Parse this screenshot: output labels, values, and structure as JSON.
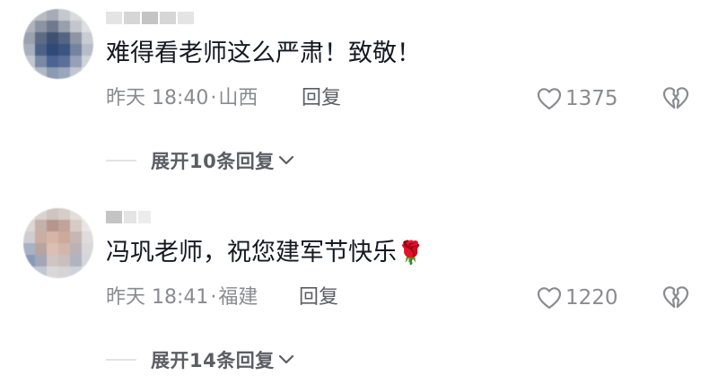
{
  "comments": [
    {
      "text": "难得看老师这么严肃！致敬！",
      "time": "昨天 18:40",
      "separator": "·",
      "location": "山西",
      "reply_label": "回复",
      "like_icon": "heart-outline-icon",
      "likes": "1375",
      "dislike_icon": "broken-heart-icon",
      "expand_label": "展开10条回复",
      "expand_icon": "chevron-down-icon"
    },
    {
      "text": "冯巩老师，祝您建军节快乐",
      "emoji": "🌹",
      "time": "昨天 18:41",
      "separator": "·",
      "location": "福建",
      "reply_label": "回复",
      "like_icon": "heart-outline-icon",
      "likes": "1220",
      "dislike_icon": "broken-heart-icon",
      "expand_label": "展开14条回复",
      "expand_icon": "chevron-down-icon"
    }
  ],
  "colors": {
    "primary_text": "#161823",
    "secondary_text": "#8a8b91",
    "action_text": "#5c5d64",
    "divider": "#e3e3e5"
  }
}
